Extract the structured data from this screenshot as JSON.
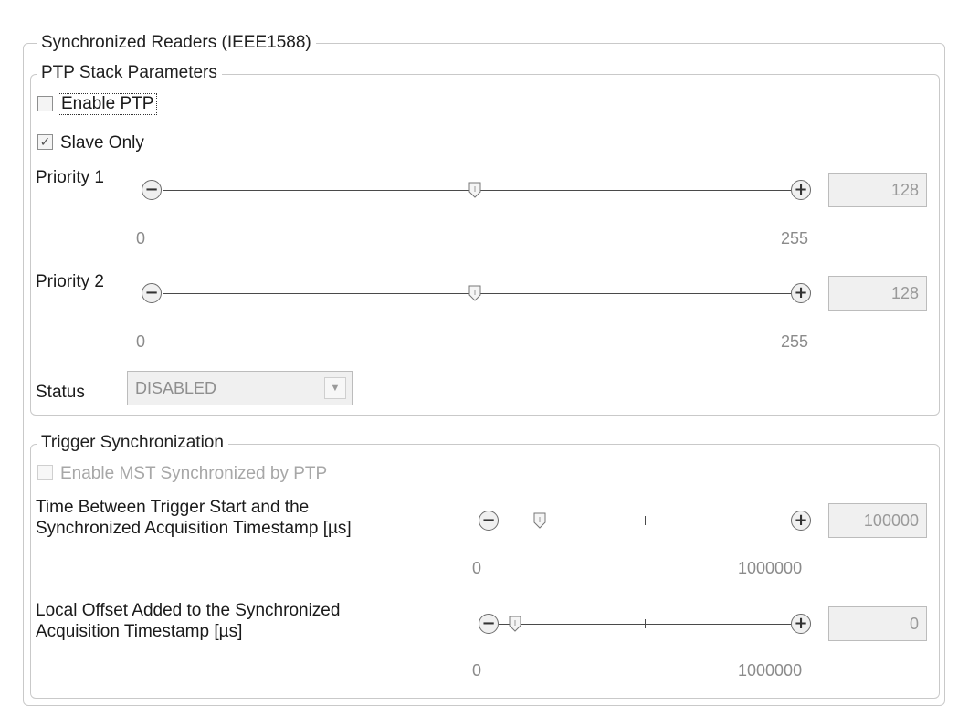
{
  "synchronized_readers": {
    "title": "Synchronized Readers (IEEE1588)",
    "ptp_stack": {
      "title": "PTP Stack Parameters",
      "enable_ptp": {
        "label": "Enable PTP",
        "checked": false
      },
      "slave_only": {
        "label": "Slave Only",
        "checked": true
      },
      "priority1": {
        "label": "Priority 1",
        "min": "0",
        "max": "255",
        "value": "128"
      },
      "priority2": {
        "label": "Priority 2",
        "min": "0",
        "max": "255",
        "value": "128"
      },
      "status": {
        "label": "Status",
        "value": "DISABLED"
      }
    },
    "trigger_sync": {
      "title": "Trigger Synchronization",
      "enable_mst": {
        "label": "Enable MST Synchronized by PTP",
        "checked": false
      },
      "time_between": {
        "label_line1": "Time Between Trigger Start and the",
        "label_line2": "Synchronized Acquisition Timestamp [µs]",
        "min": "0",
        "max": "1000000",
        "value": "100000"
      },
      "local_offset": {
        "label_line1": "Local Offset Added to the Synchronized",
        "label_line2": "Acquisition Timestamp [µs]",
        "min": "0",
        "max": "1000000",
        "value": "0"
      }
    }
  },
  "icons": {
    "minus": "−",
    "plus": "+",
    "check": "✓",
    "dropdown": "▼"
  },
  "colors": {
    "frame_border": "#c9c9c9",
    "disabled_text": "#a7a7a7",
    "textbox_bg": "#f0f0f0"
  }
}
